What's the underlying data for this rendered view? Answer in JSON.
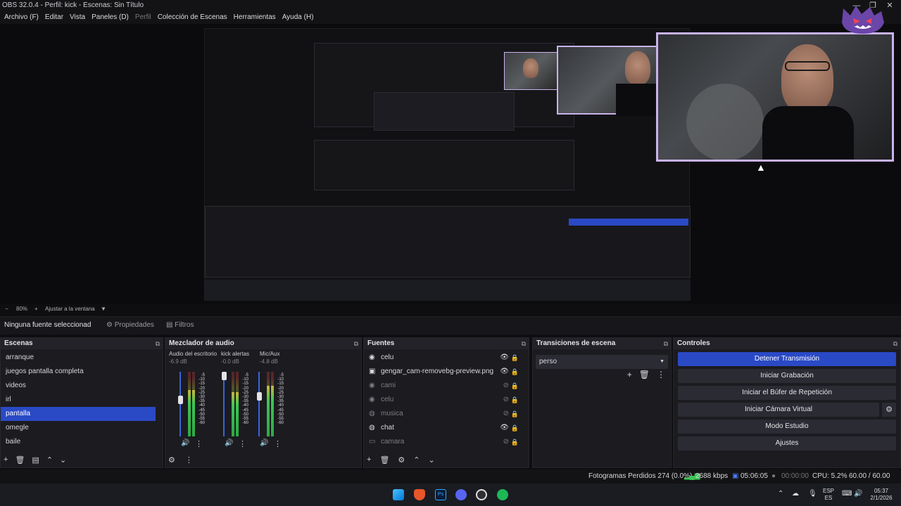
{
  "window": {
    "title": "OBS 32.0.4 - Perfil: kick - Escenas: Sin Título",
    "controls": [
      "—",
      "❐",
      "✕"
    ]
  },
  "menu": {
    "items": [
      "Archivo (F)",
      "Editar",
      "Vista",
      "Paneles (D)",
      "Perfil",
      "Colección de Escenas",
      "Herramientas",
      "Ayuda (H)"
    ]
  },
  "zoom": {
    "minus": "−",
    "value": "80%",
    "plus": "+",
    "fit": "Ajustar a la ventana",
    "arrow": "▼"
  },
  "source_bar": {
    "selected": "Ninguna fuente seleccionad",
    "properties": "Propiedades",
    "filters": "Filtros"
  },
  "scenes": {
    "title": "Escenas",
    "items": [
      "arranque",
      "juegos pantalla completa",
      "videos",
      "irl",
      "pantalla",
      "omegle",
      "baile"
    ],
    "selected_index": 4
  },
  "mixer": {
    "title": "Mezclador de audio",
    "channels": [
      {
        "name": "Audio del escritorio",
        "db": "-6.9 dB",
        "level": 0.72,
        "fader": 0.56
      },
      {
        "name": "kick alertas",
        "db": "-0.0 dB",
        "level": 0.68,
        "fader": 1.0
      },
      {
        "name": "Mic/Aux",
        "db": "-4.8 dB",
        "level": 0.78,
        "fader": 0.62
      }
    ],
    "ticks": [
      "-5",
      "-10",
      "-15",
      "-20",
      "-25",
      "-30",
      "-35",
      "-40",
      "-45",
      "-50",
      "-55",
      "-60"
    ]
  },
  "sources": {
    "title": "Fuentes",
    "items": [
      {
        "name": "celu",
        "icon": "camera-icon",
        "visible": true
      },
      {
        "name": "gengar_cam-removebg-preview.png",
        "icon": "image-icon",
        "visible": true
      },
      {
        "name": "cami",
        "icon": "camera-icon",
        "visible": false
      },
      {
        "name": "celu",
        "icon": "camera-icon",
        "visible": false
      },
      {
        "name": "musica",
        "icon": "globe-icon",
        "visible": false
      },
      {
        "name": "chat",
        "icon": "globe-icon",
        "visible": true
      },
      {
        "name": "camara",
        "icon": "display-icon",
        "visible": false
      }
    ]
  },
  "transitions": {
    "title": "Transiciones de escena",
    "selected": "perso"
  },
  "controls": {
    "title": "Controles",
    "buttons": [
      "Detener Transmisión",
      "Iniciar Grabación",
      "Iniciar el Búfer de Repetición",
      "Iniciar Cámara Virtual",
      "Modo Estudio",
      "Ajustes"
    ]
  },
  "status": {
    "dropped": "Fotogramas Perdidos 274 (0.0%)",
    "bitrate": "2688 kbps",
    "stream_time": "05:06:05",
    "rec_time": "00:00:00",
    "cpu": "CPU: 5.2%",
    "fps": "60.00 / 60.00 FPS"
  },
  "taskbar": {
    "lang": "ESP",
    "lang2": "ES",
    "time": "05:37",
    "date": "2/1/2026"
  },
  "colors": {
    "accent": "#2a49c5",
    "frame": "#c9b2ec"
  }
}
